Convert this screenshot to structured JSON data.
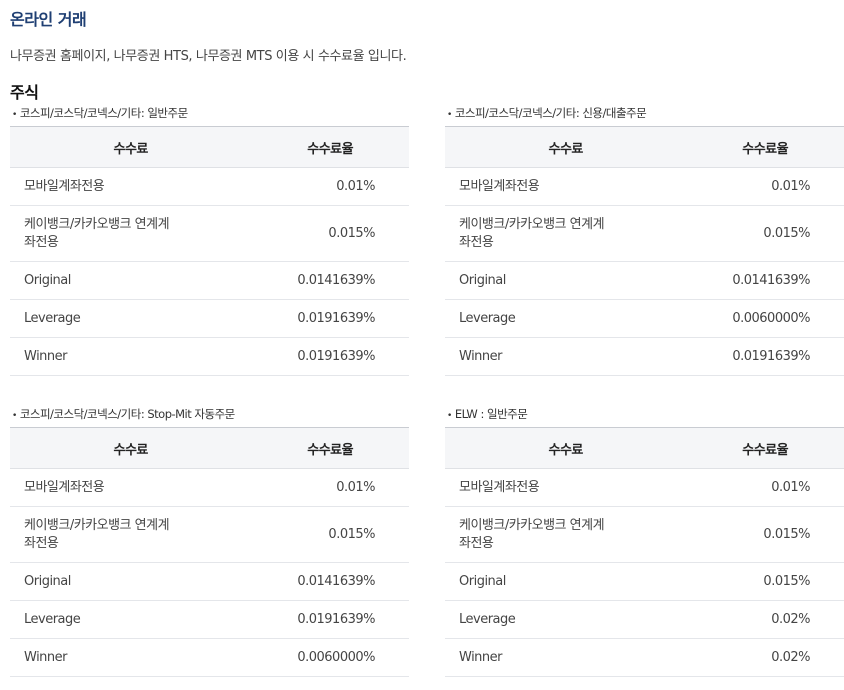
{
  "page": {
    "title": "온라인 거래",
    "intro": "나무증권 홈페이지, 나무증권 HTS, 나무증권 MTS 이용 시 수수료율 입니다.",
    "section": "주식"
  },
  "tables": [
    {
      "caption": "코스피/코스닥/코넥스/기타: 일반주문",
      "headers": [
        "수수료",
        "수수료율"
      ],
      "rows": [
        {
          "name": "모바일계좌전용",
          "rate": "0.01%"
        },
        {
          "name": "케이뱅크/카카오뱅크 연계계\n좌전용",
          "rate": "0.015%"
        },
        {
          "name": "Original",
          "rate": "0.0141639%"
        },
        {
          "name": "Leverage",
          "rate": "0.0191639%"
        },
        {
          "name": "Winner",
          "rate": "0.0191639%"
        }
      ]
    },
    {
      "caption": "코스피/코스닥/코넥스/기타: 신용/대출주문",
      "headers": [
        "수수료",
        "수수료율"
      ],
      "rows": [
        {
          "name": "모바일계좌전용",
          "rate": "0.01%"
        },
        {
          "name": "케이뱅크/카카오뱅크 연계계\n좌전용",
          "rate": "0.015%"
        },
        {
          "name": "Original",
          "rate": "0.0141639%"
        },
        {
          "name": "Leverage",
          "rate": "0.0060000%"
        },
        {
          "name": "Winner",
          "rate": "0.0191639%"
        }
      ]
    },
    {
      "caption": "코스피/코스닥/코넥스/기타: Stop-Mit 자동주문",
      "headers": [
        "수수료",
        "수수료율"
      ],
      "rows": [
        {
          "name": "모바일계좌전용",
          "rate": "0.01%"
        },
        {
          "name": "케이뱅크/카카오뱅크 연계계\n좌전용",
          "rate": "0.015%"
        },
        {
          "name": "Original",
          "rate": "0.0141639%"
        },
        {
          "name": "Leverage",
          "rate": "0.0191639%"
        },
        {
          "name": "Winner",
          "rate": "0.0060000%"
        }
      ]
    },
    {
      "caption": "ELW : 일반주문",
      "headers": [
        "수수료",
        "수수료율"
      ],
      "rows": [
        {
          "name": "모바일계좌전용",
          "rate": "0.01%"
        },
        {
          "name": "케이뱅크/카카오뱅크 연계계\n좌전용",
          "rate": "0.015%"
        },
        {
          "name": "Original",
          "rate": "0.015%"
        },
        {
          "name": "Leverage",
          "rate": "0.02%"
        },
        {
          "name": "Winner",
          "rate": "0.02%"
        }
      ]
    }
  ]
}
